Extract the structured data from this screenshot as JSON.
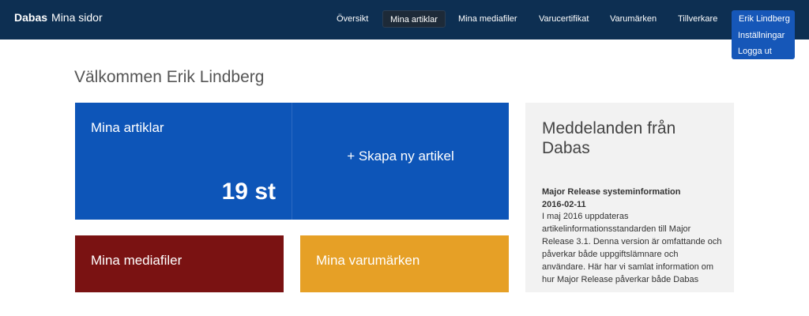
{
  "brand": {
    "bold": "Dabas",
    "sub": "Mina sidor"
  },
  "nav": {
    "items": [
      "Översikt",
      "Mina artiklar",
      "Mina mediafiler",
      "Varucertifikat",
      "Varumärken",
      "Tillverkare"
    ],
    "active_index": 1,
    "user": "Erik Lindberg",
    "dropdown": [
      "Inställningar",
      "Logga ut"
    ]
  },
  "welcome": "Välkommen Erik Lindberg",
  "tiles": {
    "articles": {
      "title": "Mina artiklar",
      "count": "19 st"
    },
    "create": {
      "label": "+ Skapa ny artikel"
    },
    "media": {
      "title": "Mina mediafiler"
    },
    "brands": {
      "title": "Mina varumärken"
    }
  },
  "messages": {
    "title": "Meddelanden från Dabas",
    "heading": "Major Release systeminformation",
    "date": "2016-02-11",
    "body": "I maj 2016 uppdateras artikelinformationsstandarden till Major Release 3.1. Denna version är omfattande och påverkar både uppgiftslämnare och användare. Här har vi samlat information om hur Major Release påverkar både Dabas"
  },
  "colors": {
    "navbar": "#0d2f52",
    "blue_tile": "#0d55b8",
    "media_tile": "#7a1212",
    "brands_tile": "#e6a026",
    "messages_bg": "#f2f2f2"
  }
}
